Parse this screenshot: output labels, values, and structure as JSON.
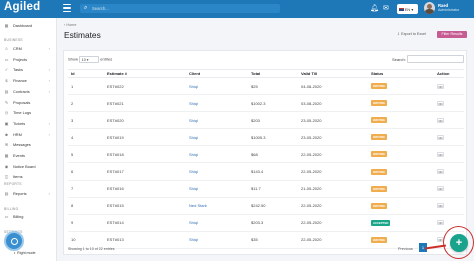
{
  "app": {
    "logo": "Agiled",
    "search_placeholder": "Search...",
    "language": "EN",
    "user_name": "Raed",
    "user_role": "Administrator"
  },
  "sidebar": {
    "dashboard": "Dashboard",
    "business_label": "BUSINESS",
    "items": [
      {
        "label": "CRM",
        "icon": "people-icon",
        "chevron": true
      },
      {
        "label": "Projects",
        "icon": "folder-icon",
        "chevron": false
      },
      {
        "label": "Tasks",
        "icon": "check-icon",
        "chevron": true
      },
      {
        "label": "Finance",
        "icon": "money-icon",
        "chevron": true
      },
      {
        "label": "Contracts",
        "icon": "document-icon",
        "chevron": true
      },
      {
        "label": "Proposals",
        "icon": "proposal-icon",
        "chevron": false
      },
      {
        "label": "Time Logs",
        "icon": "clock-icon",
        "chevron": false
      },
      {
        "label": "Tickets",
        "icon": "ticket-icon",
        "chevron": true
      },
      {
        "label": "HRM",
        "icon": "users-icon",
        "chevron": true
      },
      {
        "label": "Messages",
        "icon": "message-icon",
        "chevron": false
      },
      {
        "label": "Events",
        "icon": "calendar-icon",
        "chevron": false
      },
      {
        "label": "Notice Board",
        "icon": "notice-icon",
        "chevron": false
      },
      {
        "label": "Items",
        "icon": "box-icon",
        "chevron": false
      }
    ],
    "reports_label": "REPORTS",
    "reports": "Reports",
    "billing_label": "BILLING",
    "billing": "Billing",
    "settings_label": "SETTINGS",
    "right_mode": "Right mode"
  },
  "page": {
    "breadcrumb": "Home",
    "title": "Estimates",
    "export_label": "Export to Excel",
    "filter_label": "Filter Results"
  },
  "table": {
    "show_label": "Show",
    "show_value": "10",
    "entries_label": "entries",
    "search_label": "Search:",
    "columns": [
      "Id",
      "Estimate #",
      "Client",
      "Total",
      "Valid Till",
      "Status",
      "Action"
    ],
    "rows": [
      {
        "id": "1",
        "estimate": "EST#022",
        "client": "Shiqi",
        "total": "$25",
        "valid_till": "04-08-2020",
        "status": "WAITING"
      },
      {
        "id": "2",
        "estimate": "EST#021",
        "client": "Shiqi",
        "total": "$1002.3",
        "valid_till": "03-08-2020",
        "status": "WAITING"
      },
      {
        "id": "3",
        "estimate": "EST#020",
        "client": "Shiqi",
        "total": "$203",
        "valid_till": "23-05-2020",
        "status": "WAITING"
      },
      {
        "id": "4",
        "estimate": "EST#019",
        "client": "Shiqi",
        "total": "$1005.3",
        "valid_till": "23-05-2020",
        "status": "WAITING"
      },
      {
        "id": "5",
        "estimate": "EST#018",
        "client": "Shiqi",
        "total": "$68",
        "valid_till": "22-05-2020",
        "status": "WAITING"
      },
      {
        "id": "6",
        "estimate": "EST#017",
        "client": "Shiqi",
        "total": "$143.4",
        "valid_till": "22-05-2020",
        "status": "WAITING"
      },
      {
        "id": "7",
        "estimate": "EST#016",
        "client": "Shiqi",
        "total": "$11.7",
        "valid_till": "21-05-2020",
        "status": "WAITING"
      },
      {
        "id": "8",
        "estimate": "EST#015",
        "client": "Ned Stark",
        "total": "$242.50",
        "valid_till": "22-05-2020",
        "status": "WAITING"
      },
      {
        "id": "9",
        "estimate": "EST#014",
        "client": "Shiqi",
        "total": "$203.3",
        "valid_till": "22-05-2020",
        "status": "ACCEPTED"
      },
      {
        "id": "10",
        "estimate": "EST#013",
        "client": "Shiqi",
        "total": "$35",
        "valid_till": "22-05-2020",
        "status": "WAITING"
      }
    ],
    "action_label": "•••",
    "info": "Showing 1 to 10 of 22 entries",
    "previous_label": "Previous",
    "current_page": "1"
  },
  "fab_label": "+",
  "colors": {
    "topbar": "#1e78b8",
    "waiting": "#f0ad4e",
    "accepted": "#1ba68a",
    "filter_button": "#c75c92",
    "fab": "#19a28c"
  }
}
